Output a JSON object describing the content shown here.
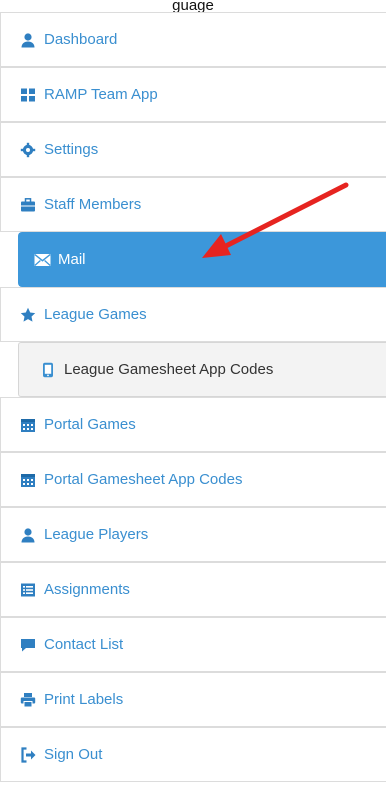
{
  "header": {
    "clipped_text": "guage"
  },
  "nav": {
    "items": [
      {
        "label": "Dashboard",
        "icon": "user-icon"
      },
      {
        "label": "RAMP Team App",
        "icon": "grid-icon"
      },
      {
        "label": "Settings",
        "icon": "gear-icon"
      },
      {
        "label": "Staff Members",
        "icon": "briefcase-icon"
      },
      {
        "label": "Mail",
        "icon": "envelope-icon",
        "active": true
      },
      {
        "label": "League Games",
        "icon": "star-icon"
      },
      {
        "label": "League Gamesheet App Codes",
        "icon": "mobile-icon",
        "sub": true
      },
      {
        "label": "Portal Games",
        "icon": "calendar-icon"
      },
      {
        "label": "Portal Gamesheet App Codes",
        "icon": "calendar-icon"
      },
      {
        "label": "League Players",
        "icon": "user-icon"
      },
      {
        "label": "Assignments",
        "icon": "list-icon"
      },
      {
        "label": "Contact List",
        "icon": "comment-icon"
      },
      {
        "label": "Print Labels",
        "icon": "print-icon"
      },
      {
        "label": "Sign Out",
        "icon": "sign-out-icon"
      }
    ]
  },
  "colors": {
    "accent": "#3c97da",
    "link": "#3a8fd0",
    "arrow": "#e62420"
  }
}
